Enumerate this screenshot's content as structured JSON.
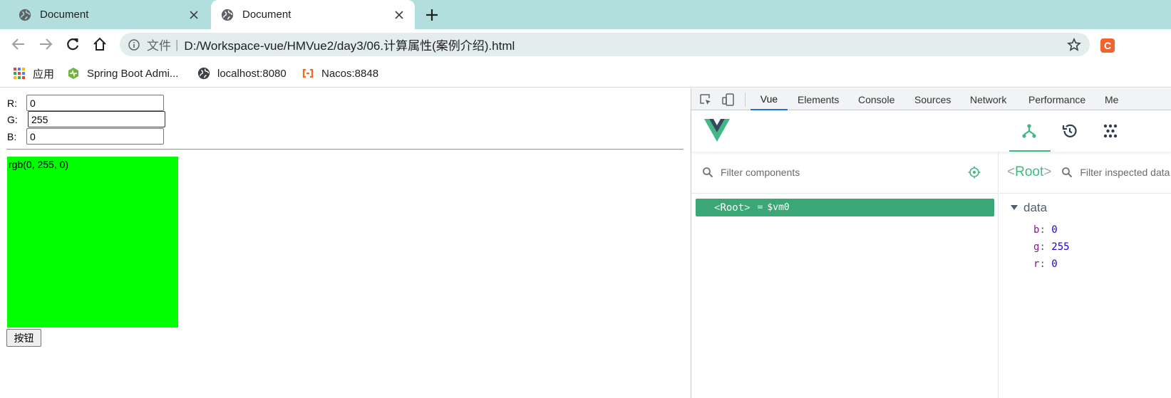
{
  "tabs": [
    {
      "title": "Document",
      "active": false
    },
    {
      "title": "Document",
      "active": true
    }
  ],
  "toolbar": {
    "scheme_label": "文件",
    "separator": "|",
    "url": "D:/Workspace-vue/HMVue2/day3/06.计算属性(案例介绍).html",
    "extension_badge": "C"
  },
  "bookmarks": [
    {
      "label": "应用",
      "icon": "apps-grid-icon"
    },
    {
      "label": "Spring Boot Admi...",
      "icon": "spring-boot-admin-icon"
    },
    {
      "label": "localhost:8080",
      "icon": "globe-icon"
    },
    {
      "label": "Nacos:8848",
      "icon": "nacos-icon"
    }
  ],
  "page": {
    "fields": [
      {
        "label": "R:",
        "value": "0"
      },
      {
        "label": "G:",
        "value": "255"
      },
      {
        "label": "B:",
        "value": "0"
      }
    ],
    "color_box_text": "rgb(0, 255, 0)",
    "color_box_color": "#00ff00",
    "button_label": "按钮"
  },
  "devtools": {
    "tabs": [
      "Vue",
      "Elements",
      "Console",
      "Sources",
      "Network",
      "Performance",
      "Me"
    ],
    "active_tab": "Vue",
    "filter_placeholder": "Filter components",
    "root_row": {
      "tag": "Root",
      "lt": "<",
      "gt": ">",
      "eq": "=",
      "var": "$vm0"
    },
    "inspector": {
      "lt": "<",
      "title": "Root",
      "gt": ">",
      "filter_placeholder": "Filter inspected data",
      "section": "data",
      "props": [
        {
          "key": "b",
          "value": "0"
        },
        {
          "key": "g",
          "value": "255"
        },
        {
          "key": "r",
          "value": "0"
        }
      ]
    },
    "accent_color": "#42b883"
  }
}
